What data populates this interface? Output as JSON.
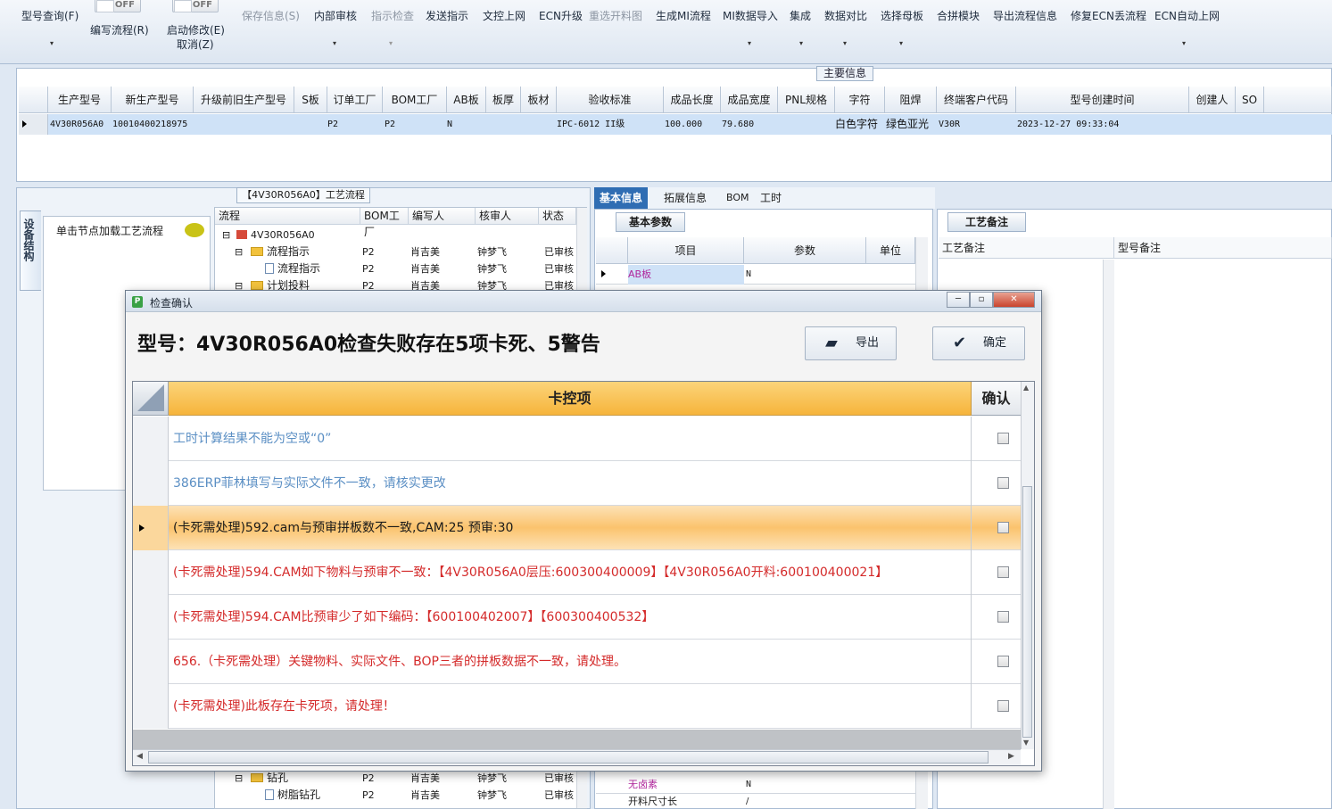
{
  "toolbar": {
    "model_query": "型号查询(F)",
    "write_flow_toggle": "OFF",
    "write_flow": "编写流程(R)",
    "start_edit_toggle": "OFF",
    "start_edit": "启动修改(E)",
    "cancel": "取消(Z)",
    "save_info": "保存信息(S)",
    "internal_review": "内部审核",
    "indicator_check": "指示检查",
    "send_indicator": "发送指示",
    "upload_doc": "文控上网",
    "ecn_upgrade": "ECN升级",
    "reselect_cut_drawing": "重选开料图",
    "generate_mi": "生成MI流程",
    "mi_import": "MI数据导入",
    "integrate": "集成",
    "data_compare": "数据对比",
    "select_mother_board": "选择母板",
    "merge_module": "合拼模块",
    "export_flow_info": "导出流程信息",
    "fix_ecn_lost_flow": "修复ECN丢流程",
    "ecn_auto_upload": "ECN自动上网"
  },
  "main_info": {
    "title": "主要信息",
    "columns": [
      "生产型号",
      "新生产型号",
      "升级前旧生产型号",
      "S板",
      "订单工厂",
      "BOM工厂",
      "AB板",
      "板厚",
      "板材",
      "验收标准",
      "成品长度",
      "成品宽度",
      "PNL规格",
      "字符",
      "阻焊",
      "终端客户代码",
      "型号创建时间",
      "创建人",
      "SO"
    ],
    "row": {
      "prod_model": "4V30R056A0",
      "new_model": "10010400218975",
      "order_factory": "P2",
      "bom_factory": "P2",
      "ab_board": "N",
      "standard": "IPC-6012 II级",
      "length": "100.000",
      "width": "79.680",
      "char": "白色字符",
      "solder": "绿色亚光",
      "customer": "V30R",
      "created": "2023-12-27 09:33:04"
    }
  },
  "left_panel": {
    "title": "【4V30R056A0】工艺流程",
    "vertical_tab": "设备结构",
    "node_hint": "单击节点加载工艺流程",
    "tree_columns": [
      "流程",
      "BOM工厂",
      "编写人",
      "核审人",
      "状态"
    ],
    "tree_rows": [
      {
        "name": "4V30R056A0",
        "bom": "",
        "writer": "",
        "reviewer": "",
        "status": ""
      },
      {
        "name": "流程指示",
        "bom": "P2",
        "writer": "肖吉美",
        "reviewer": "钟梦飞",
        "status": "已审核"
      },
      {
        "name": "流程指示",
        "bom": "P2",
        "writer": "肖吉美",
        "reviewer": "钟梦飞",
        "status": "已审核"
      },
      {
        "name": "计划投料",
        "bom": "P2",
        "writer": "肖吉美",
        "reviewer": "钟梦飞",
        "status": "已审核"
      }
    ],
    "tree_bottom_rows": [
      {
        "name": "钻孔",
        "bom": "P2",
        "writer": "肖吉美",
        "reviewer": "钟梦飞",
        "status": "已审核"
      },
      {
        "name": "树脂钻孔",
        "bom": "P2",
        "writer": "肖吉美",
        "reviewer": "钟梦飞",
        "status": "已审核"
      }
    ]
  },
  "right_tabs": [
    "基本信息",
    "拓展信息",
    "BOM",
    "工时"
  ],
  "basic_params": {
    "title": "基本参数",
    "columns": [
      "项目",
      "参数",
      "单位"
    ],
    "rows": [
      {
        "item": "AB板",
        "value": "N"
      }
    ],
    "bottom_rows": [
      {
        "item": "无卤素",
        "value": "N"
      },
      {
        "item": "开料尺寸长",
        "value": "/"
      }
    ]
  },
  "process_notes": {
    "title": "工艺备注",
    "columns": [
      "工艺备注",
      "型号备注"
    ]
  },
  "dialog": {
    "title": "检查确认",
    "heading": "型号：4V30R056A0检查失败存在5项卡死、5警告",
    "export_label": "导出",
    "confirm_label": "确定",
    "col_item": "卡控项",
    "col_confirm": "确认",
    "rows": [
      {
        "text": "工时计算结果不能为空或“0”",
        "color": "#5b8fc4"
      },
      {
        "text": "386ERP菲林填写与实际文件不一致，请核实更改",
        "color": "#5b8fc4"
      },
      {
        "text": "(卡死需处理)592.cam与预审拼板数不一致,CAM:25 预审:30",
        "color": "#1a1a1a"
      },
      {
        "text": "(卡死需处理)594.CAM如下物料与预审不一致：【4V30R056A0层压:600300400009】【4V30R056A0开料:600100400021】",
        "color": "#d42a2a"
      },
      {
        "text": "(卡死需处理)594.CAM比预审少了如下编码：【600100402007】【600300400532】",
        "color": "#d42a2a"
      },
      {
        "text": "656.（卡死需处理）关键物料、实际文件、BOP三者的拼板数据不一致，请处理。",
        "color": "#d42a2a"
      },
      {
        "text": "(卡死需处理)此板存在卡死项，请处理！",
        "color": "#d42a2a"
      }
    ]
  }
}
